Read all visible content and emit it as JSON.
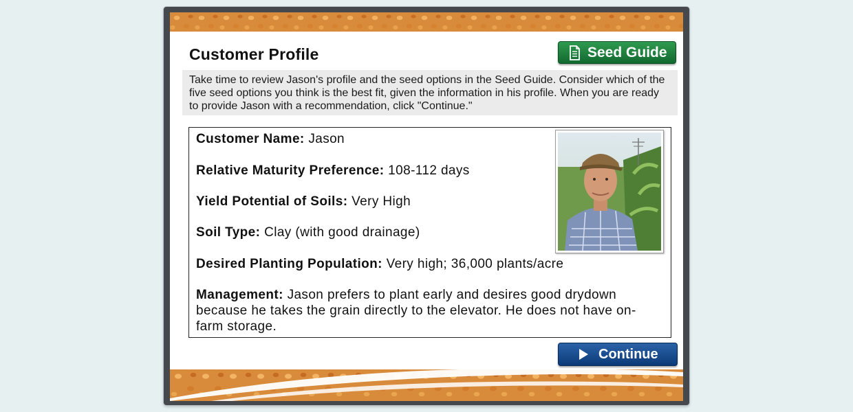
{
  "header": {
    "title": "Customer Profile",
    "seed_guide_label": "Seed Guide"
  },
  "intro": {
    "text": "Take time to review Jason's profile and the seed options in the Seed Guide.  Consider which of the five seed options you think is the best fit, given the information in his profile.  When you are ready to provide Jason with a recommendation, click \"Continue.\""
  },
  "profile": {
    "fields": [
      {
        "label": "Customer Name:",
        "value": "Jason"
      },
      {
        "label": "Relative Maturity Preference:",
        "value": "108-112 days"
      },
      {
        "label": "Yield Potential of Soils:",
        "value": "Very High"
      },
      {
        "label": "Soil Type:",
        "value": "Clay (with good drainage)"
      },
      {
        "label": "Desired Planting Population:",
        "value": "Very high; 36,000 plants/acre"
      },
      {
        "label": "Management:",
        "value": "Jason prefers to plant early and desires good drydown because he takes the grain directly to the elevator.  He does not have on-farm storage."
      }
    ]
  },
  "footer": {
    "continue_label": "Continue"
  },
  "icons": {
    "seed_guide": "document-icon",
    "continue": "play-icon"
  },
  "colors": {
    "seed_guide_button": "#1b7a3a",
    "continue_button": "#0f447f",
    "page_background": "#e6f0f1"
  }
}
